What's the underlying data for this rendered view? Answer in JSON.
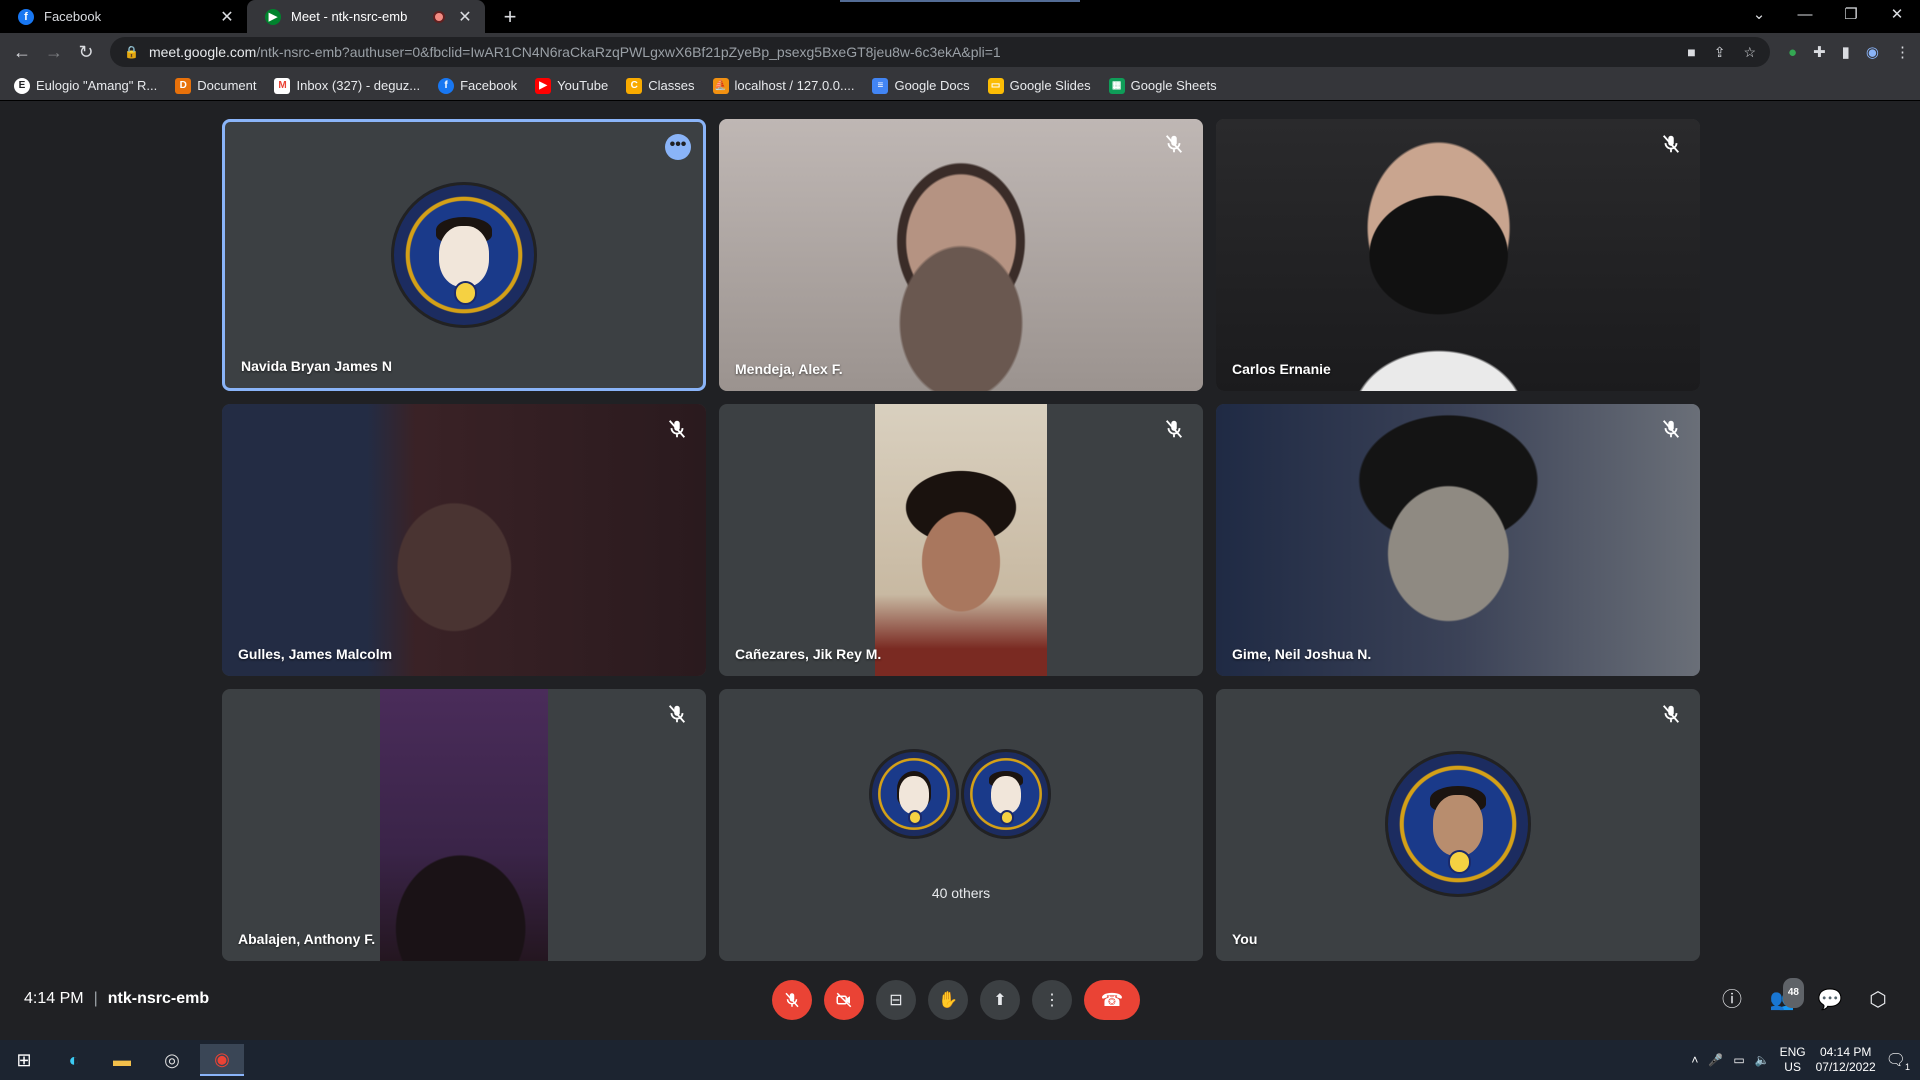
{
  "browser": {
    "tabs": [
      {
        "title": "Facebook",
        "favicon": "facebook-icon",
        "active": false
      },
      {
        "title": "Meet - ntk-nsrc-emb",
        "favicon": "meet-icon",
        "active": true
      }
    ],
    "url_host": "meet.google.com",
    "url_path": "/ntk-nsrc-emb?authuser=0&fbclid=IwAR1CN4N6raCkaRzqPWLgxwX6Bf21pZyeBp_psexg5BxeGT8jeu8w-6c3ekA&pli=1",
    "bookmarks": [
      {
        "label": "Eulogio \"Amang\" R...",
        "icon": "bookmark-site-icon",
        "color": "#ffffff"
      },
      {
        "label": "Document",
        "icon": "document-icon",
        "color": "#e8710a"
      },
      {
        "label": "Inbox (327) - deguz...",
        "icon": "gmail-icon",
        "color": "#ea4335"
      },
      {
        "label": "Facebook",
        "icon": "facebook-icon",
        "color": "#1877f2"
      },
      {
        "label": "YouTube",
        "icon": "youtube-icon",
        "color": "#ff0000"
      },
      {
        "label": "Classes",
        "icon": "classroom-icon",
        "color": "#f9ab00"
      },
      {
        "label": "localhost / 127.0.0....",
        "icon": "phpmyadmin-icon",
        "color": "#f29111"
      },
      {
        "label": "Google Docs",
        "icon": "docs-icon",
        "color": "#4285f4"
      },
      {
        "label": "Google Slides",
        "icon": "slides-icon",
        "color": "#fbbc04"
      },
      {
        "label": "Google Sheets",
        "icon": "sheets-icon",
        "color": "#0f9d58"
      }
    ]
  },
  "meet": {
    "participants": [
      {
        "name": "Navida Bryan James N",
        "type": "avatar",
        "active_speaker": true,
        "muted": false
      },
      {
        "name": "Mendeja, Alex F.",
        "type": "video",
        "muted": true
      },
      {
        "name": "Carlos Ernanie",
        "type": "video",
        "muted": true
      },
      {
        "name": "Gulles, James Malcolm",
        "type": "video",
        "muted": true
      },
      {
        "name": "Cañezares, Jik Rey M.",
        "type": "video",
        "muted": true
      },
      {
        "name": "Gime, Neil Joshua N.",
        "type": "video",
        "muted": true
      },
      {
        "name": "Abalajen, Anthony F.",
        "type": "video",
        "muted": true
      },
      {
        "name": "",
        "type": "others",
        "muted": false
      },
      {
        "name": "You",
        "type": "avatar",
        "muted": true
      }
    ],
    "others_label": "40 others",
    "time": "4:14 PM",
    "meeting_code": "ntk-nsrc-emb",
    "people_count": "48",
    "accent": "#8ab4f8",
    "hangup_color": "#ea4335"
  },
  "taskbar": {
    "lang_line1": "ENG",
    "lang_line2": "US",
    "time": "04:14 PM",
    "date": "07/12/2022",
    "notifications": "1"
  }
}
